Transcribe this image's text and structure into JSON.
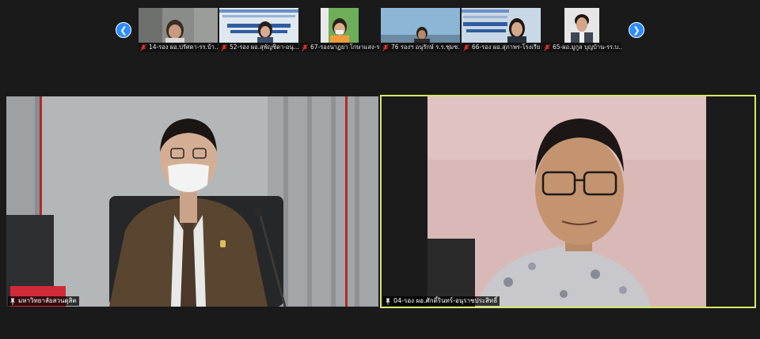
{
  "participants_strip": [
    {
      "name": "14-รอง ผอ.ปรัศดา-รร.บ้า...",
      "bg": "#8a8c8a",
      "muted": true
    },
    {
      "name": "52-รอง ผอ.สุพัญชิดา-อนุ...",
      "bg": "#dfe8ef",
      "muted": true
    },
    {
      "name": "67-รองนาฏยา โกษาแสง-ร...",
      "bg": "#6fae58",
      "muted": true
    },
    {
      "name": "76 รองฯ อนุรักษ์ ร.ร.ชุมช...",
      "bg": "#8cb6d6",
      "muted": true
    },
    {
      "name": "66-รอง ผอ.สุภาพร-โรงเรีย...",
      "bg": "#c9d8e6",
      "muted": true
    },
    {
      "name": "65-ผอ.มูกูล บุญบ้าน-รร.บ...",
      "bg": "#e6e6e6",
      "muted": true
    }
  ],
  "nav": {
    "prev_icon": "chevron-left-icon",
    "next_icon": "chevron-right-icon",
    "prev": "❮",
    "next": "❯"
  },
  "main_left": {
    "name": "มหาวิทยาลัยสวนดุสิต",
    "pinned": true
  },
  "main_right": {
    "name": "04-รอง ผอ.ศักดิ์รินทร์-อนุราชประสิทธิ์",
    "pinned": true,
    "active_speaker": true
  },
  "colors": {
    "accent": "#2d8cff",
    "active_border": "#d6e86a",
    "muted": "#e0322d"
  }
}
